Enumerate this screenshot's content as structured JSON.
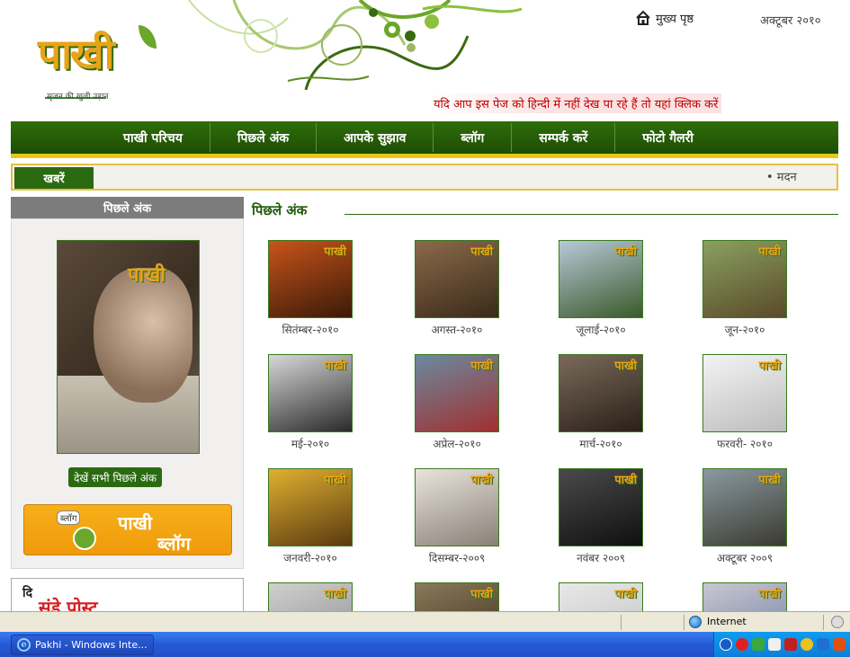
{
  "header": {
    "logo_text": "पाखी",
    "logo_tagline": "सृजन की खुली उड़ान",
    "home_link": "मुख्य पृष्ठ",
    "date": "अक्टूबर २०१०",
    "hindi_notice": "यदि आप इस पेज को हिन्दी में नहीं देख पा रहे हैं तो यहां क्लिक करें"
  },
  "nav": {
    "items": [
      "पाखी परिचय",
      "पिछले अंक",
      "आपके सुझाव",
      "ब्लॉग",
      "सम्पर्क करें",
      "फोटो गैलरी"
    ]
  },
  "ticker": {
    "label": "खबरें",
    "text": "• मदन"
  },
  "sidebar": {
    "heading": "पिछले अंक",
    "see_all": "देखें सभी पिछले अंक",
    "blog_bubble": "ब्लॉग",
    "blog_title": "पाखी",
    "blog_sub": "ब्लॉग",
    "ad_small": "दि",
    "ad_big": "संडे पोस्ट"
  },
  "main": {
    "heading": "पिछले अंक",
    "issues": [
      {
        "label": "सितंम्बर-२०१०",
        "color1": "#c8541a",
        "color2": "#3a1a08"
      },
      {
        "label": "अगस्त-२०१०",
        "color1": "#8a6a4a",
        "color2": "#3a2a1a"
      },
      {
        "label": "जूलाई-२०१०",
        "color1": "#b8c8d8",
        "color2": "#3a5a2a"
      },
      {
        "label": "जून-२०१०",
        "color1": "#8aa060",
        "color2": "#5a4a2a"
      },
      {
        "label": "मई-२०१०",
        "color1": "#d8d8d8",
        "color2": "#2a2a2a"
      },
      {
        "label": "अप्रेल-२०१०",
        "color1": "#6a8aa0",
        "color2": "#a03030"
      },
      {
        "label": "मार्च-२०१०",
        "color1": "#7a6a5a",
        "color2": "#2a2018"
      },
      {
        "label": "फरवरी- २०१०",
        "color1": "#f4f4f4",
        "color2": "#bcbcbc"
      },
      {
        "label": "जनवरी-२०१०",
        "color1": "#e0b030",
        "color2": "#5a3a10"
      },
      {
        "label": "दिसम्बर-२००९",
        "color1": "#e8e4dc",
        "color2": "#8a8078"
      },
      {
        "label": "नवंबर २००९",
        "color1": "#4a4a4a",
        "color2": "#101010"
      },
      {
        "label": "अक्टूबर २००९",
        "color1": "#8a9aa0",
        "color2": "#3a3a30"
      },
      {
        "label": "",
        "color1": "#d0d0d0",
        "color2": "#8a8a8a"
      },
      {
        "label": "",
        "color1": "#8a7a5a",
        "color2": "#3a2a1a"
      },
      {
        "label": "",
        "color1": "#e8e8e8",
        "color2": "#c0c0c0"
      },
      {
        "label": "",
        "color1": "#c8c8d0",
        "color2": "#6a7aa0"
      }
    ]
  },
  "statusbar": {
    "zone": "Internet"
  },
  "taskbar": {
    "window_title": "Pakhi - Windows Inte..."
  },
  "colors": {
    "brand_green": "#2a6a10",
    "accent_yellow": "#e8c81a",
    "notice_red": "#c00000",
    "logo_orange": "#e8a317"
  }
}
